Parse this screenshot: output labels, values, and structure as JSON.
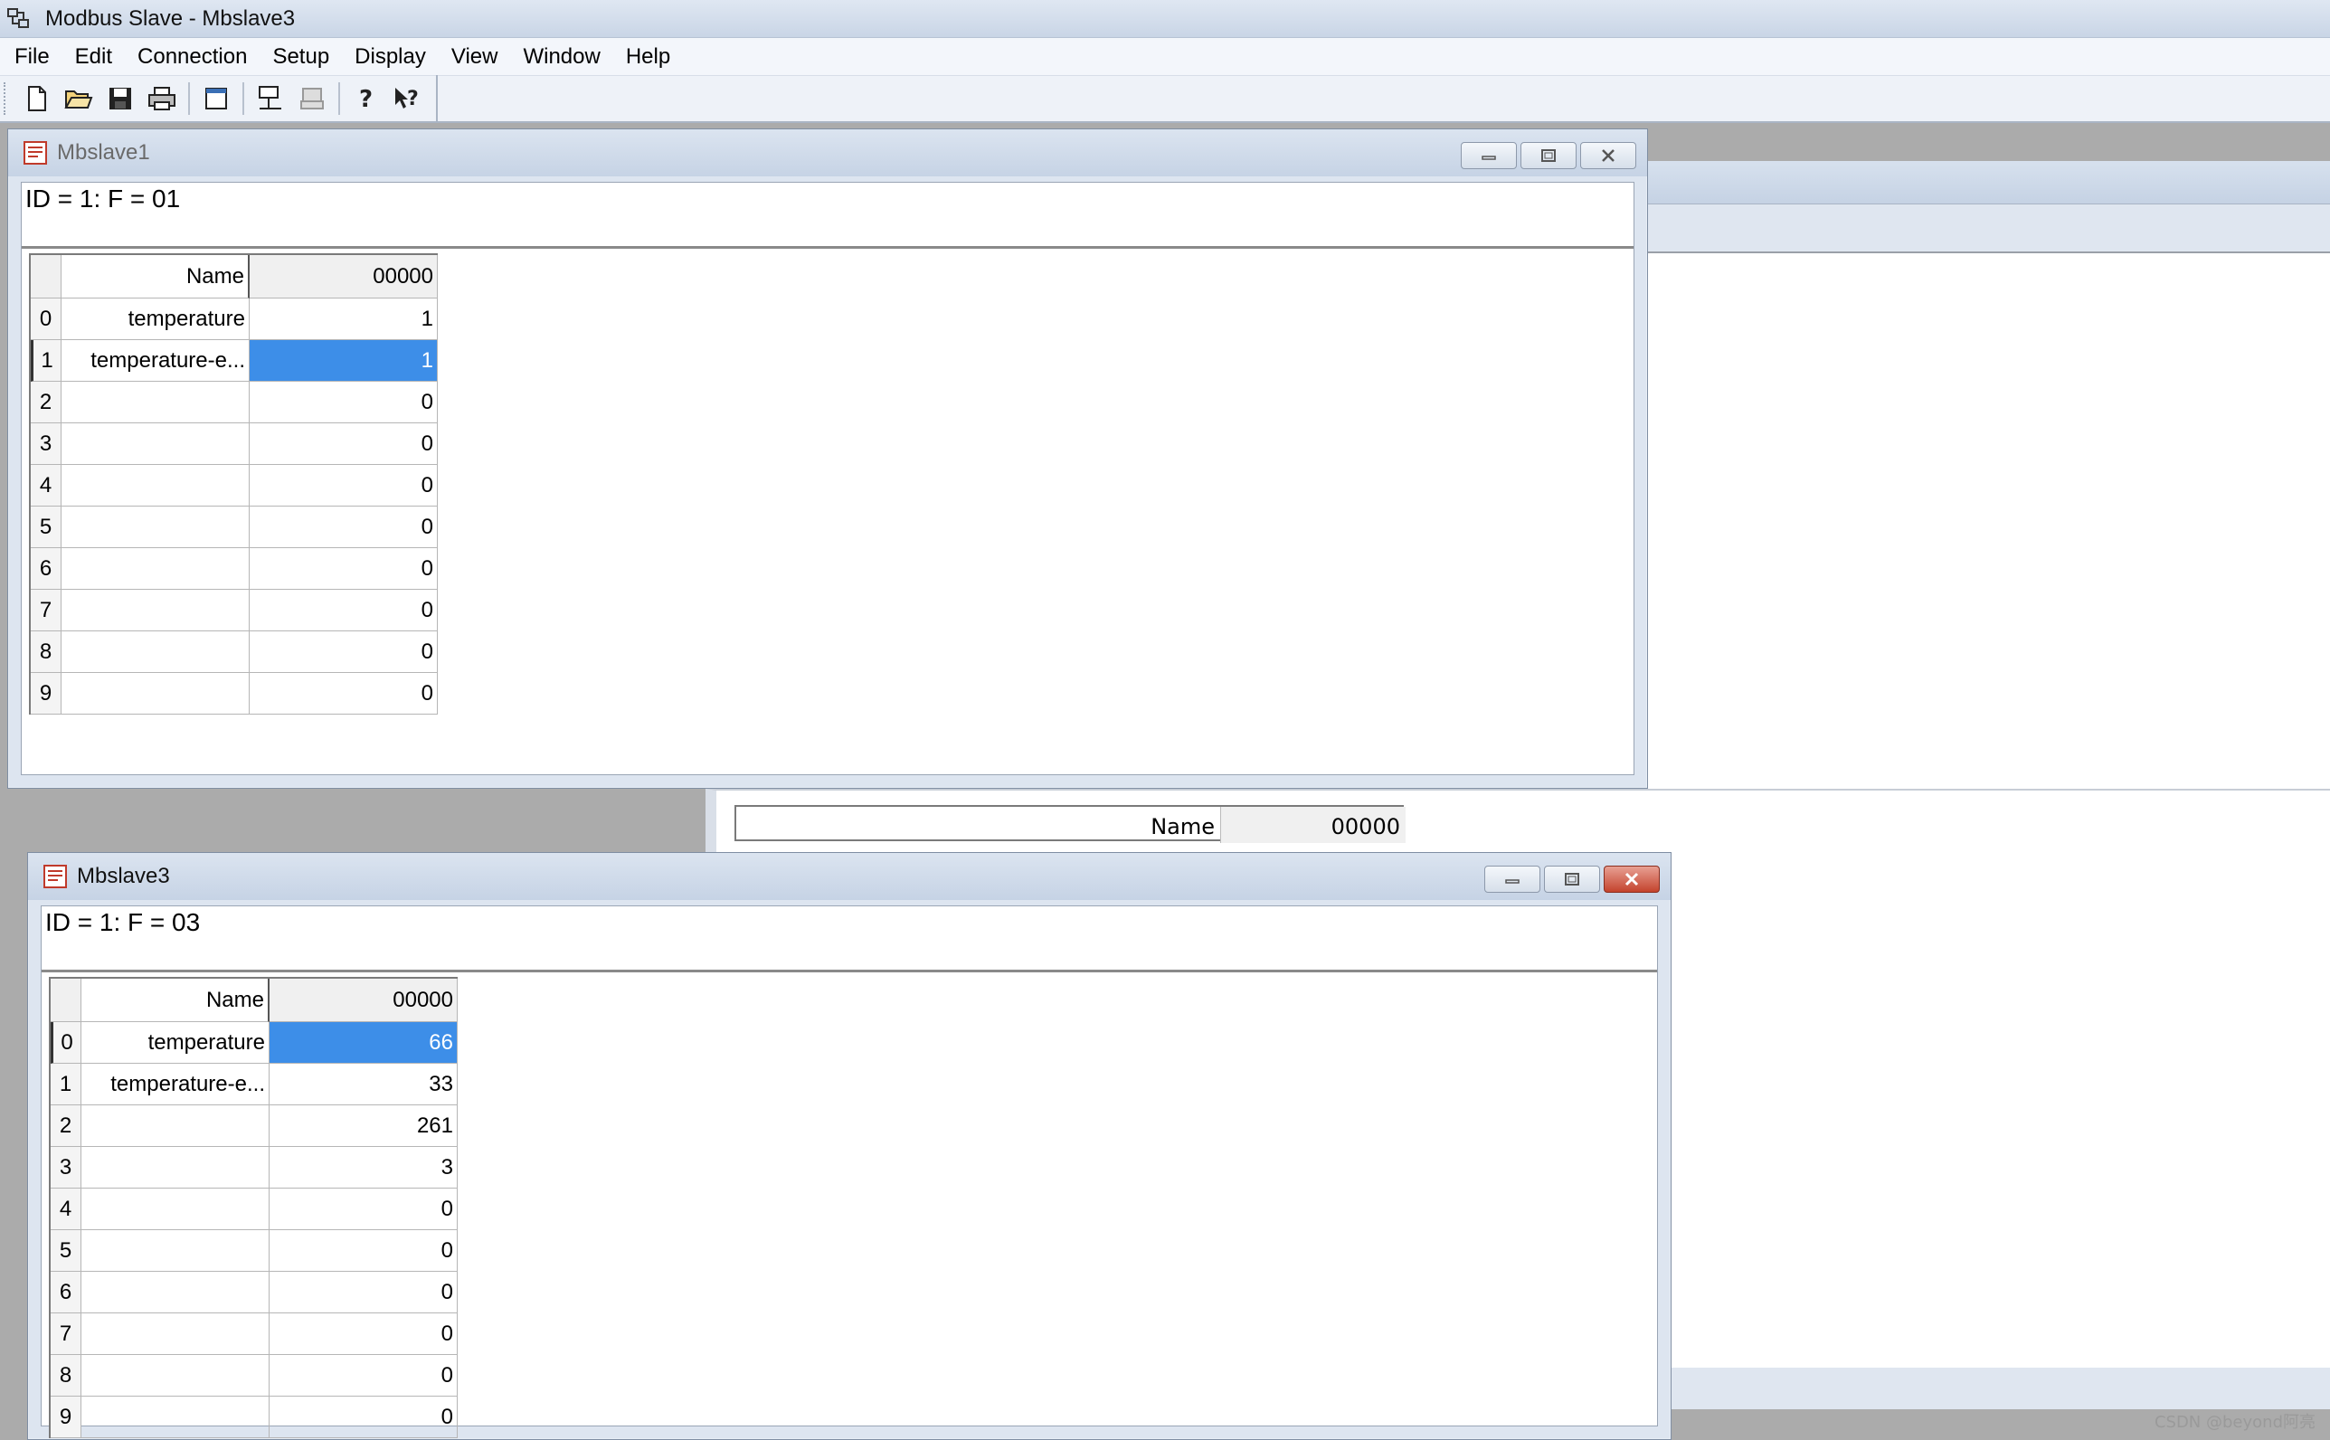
{
  "app": {
    "title": "Modbus Slave - Mbslave3"
  },
  "menu": {
    "items": [
      "File",
      "Edit",
      "Connection",
      "Setup",
      "Display",
      "View",
      "Window",
      "Help"
    ]
  },
  "toolbar": {
    "icons": [
      "new-document-icon",
      "open-folder-icon",
      "save-icon",
      "print-icon",
      "window-icon",
      "connect-icon",
      "disconnect-icon",
      "help-icon",
      "context-help-icon"
    ]
  },
  "background_window": {
    "name_header": "Name",
    "address_header": "00000"
  },
  "window1": {
    "title": "Mbslave1",
    "id_line": "ID = 1: F = 01",
    "name_header": "Name",
    "address_header": "00000",
    "rows": [
      {
        "num": "0",
        "name": "temperature",
        "value": "1"
      },
      {
        "num": "1",
        "name": "temperature-e...",
        "value": "1"
      },
      {
        "num": "2",
        "name": "",
        "value": "0"
      },
      {
        "num": "3",
        "name": "",
        "value": "0"
      },
      {
        "num": "4",
        "name": "",
        "value": "0"
      },
      {
        "num": "5",
        "name": "",
        "value": "0"
      },
      {
        "num": "6",
        "name": "",
        "value": "0"
      },
      {
        "num": "7",
        "name": "",
        "value": "0"
      },
      {
        "num": "8",
        "name": "",
        "value": "0"
      },
      {
        "num": "9",
        "name": "",
        "value": "0"
      }
    ],
    "selected_row": "1"
  },
  "window3": {
    "title": "Mbslave3",
    "id_line": "ID = 1: F = 03",
    "name_header": "Name",
    "address_header": "00000",
    "rows": [
      {
        "num": "0",
        "name": "temperature",
        "value": "66"
      },
      {
        "num": "1",
        "name": "temperature-e...",
        "value": "33"
      },
      {
        "num": "2",
        "name": "",
        "value": "261"
      },
      {
        "num": "3",
        "name": "",
        "value": "3"
      },
      {
        "num": "4",
        "name": "",
        "value": "0"
      },
      {
        "num": "5",
        "name": "",
        "value": "0"
      },
      {
        "num": "6",
        "name": "",
        "value": "0"
      },
      {
        "num": "7",
        "name": "",
        "value": "0"
      },
      {
        "num": "8",
        "name": "",
        "value": "0"
      },
      {
        "num": "9",
        "name": "",
        "value": "0"
      }
    ],
    "selected_row": "0"
  },
  "watermark": "CSDN @beyond阿亮",
  "colors": {
    "selection": "#3d8ee8",
    "close_active": "#c4432d"
  }
}
